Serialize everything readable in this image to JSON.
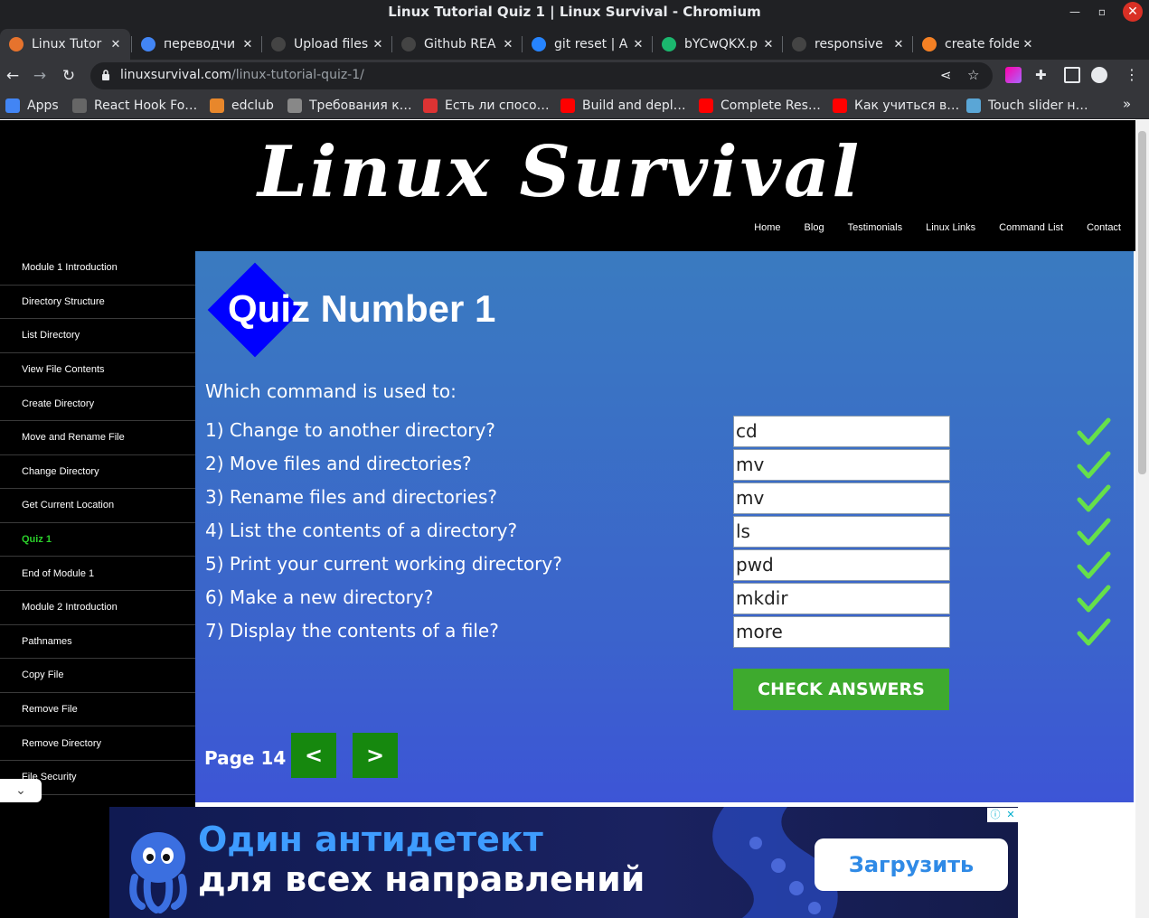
{
  "window": {
    "title": "Linux Tutorial Quiz 1 | Linux Survival - Chromium"
  },
  "tabs": [
    {
      "label": "Linux Tutor",
      "favicon": "linux-tutorial-favicon",
      "color": "#e6732d"
    },
    {
      "label": "переводчи",
      "favicon": "google-icon",
      "color": "#4285f4"
    },
    {
      "label": "Upload files",
      "favicon": "github-icon",
      "color": "#444"
    },
    {
      "label": "Github REA",
      "favicon": "github-icon",
      "color": "#444"
    },
    {
      "label": "git reset | A",
      "favicon": "atlassian-icon",
      "color": "#2684ff"
    },
    {
      "label": "bYCwQKX.p",
      "favicon": "imgur-icon",
      "color": "#1bb76e"
    },
    {
      "label": "responsive",
      "favicon": "github-icon",
      "color": "#444"
    },
    {
      "label": "create folde",
      "favicon": "stackoverflow-icon",
      "color": "#f48024"
    }
  ],
  "toolbar": {
    "url_host": "linuxsurvival.com",
    "url_path": "/linux-tutorial-quiz-1/"
  },
  "bookmarks": [
    {
      "label": "Apps",
      "icon": "apps-grid-icon",
      "color": "#4285f4"
    },
    {
      "label": "React Hook Fo…",
      "icon": "react-hook-form-icon",
      "color": "#666"
    },
    {
      "label": "edclub",
      "icon": "edclub-icon",
      "color": "#e8872b"
    },
    {
      "label": "Требования к…",
      "icon": "globe-icon",
      "color": "#888"
    },
    {
      "label": "Есть ли спосо…",
      "icon": "qa-icon",
      "color": "#d33"
    },
    {
      "label": "Build and depl…",
      "icon": "youtube-icon",
      "color": "#ff0000"
    },
    {
      "label": "Complete Res…",
      "icon": "youtube-icon",
      "color": "#ff0000"
    },
    {
      "label": "Как учиться в…",
      "icon": "youtube-icon",
      "color": "#ff0000"
    },
    {
      "label": "Touch slider н…",
      "icon": "codepen-icon",
      "color": "#5aa6d6"
    }
  ],
  "site": {
    "logo": "Linux Survival",
    "nav": [
      "Home",
      "Blog",
      "Testimonials",
      "Linux Links",
      "Command List",
      "Contact"
    ]
  },
  "sidebar": [
    "Module 1 Introduction",
    "Directory Structure",
    "List Directory",
    "View File Contents",
    "Create Directory",
    "Move and Rename File",
    "Change Directory",
    "Get Current Location",
    "Quiz 1",
    "End of Module 1",
    "Module 2 Introduction",
    "Pathnames",
    "Copy File",
    "Remove File",
    "Remove Directory",
    "File Security"
  ],
  "sidebar_active": "Quiz 1",
  "quiz": {
    "title": "Quiz Number 1",
    "prompt": "Which command is used to:",
    "questions": [
      {
        "text": "1) Change to another directory?",
        "answer": "cd"
      },
      {
        "text": "2) Move files and directories?",
        "answer": "mv"
      },
      {
        "text": "3) Rename files and directories?",
        "answer": "mv"
      },
      {
        "text": "4) List the contents of a directory?",
        "answer": "ls"
      },
      {
        "text": "5) Print your current working directory?",
        "answer": "pwd"
      },
      {
        "text": "6) Make a new directory?",
        "answer": "mkdir"
      },
      {
        "text": "7) Display the contents of a file?",
        "answer": "more"
      }
    ],
    "check_label": "CHECK ANSWERS",
    "page_label": "Page 14",
    "prev_label": "<",
    "next_label": ">"
  },
  "ad": {
    "line1": "Один антидетект",
    "line2": "для всех направлений",
    "button": "Загрузить"
  },
  "colors": {
    "accent_green": "#3eaa2e",
    "check_green": "#66e04a",
    "active_sidebar": "#2bd02b",
    "diamond": "#0000ff"
  }
}
